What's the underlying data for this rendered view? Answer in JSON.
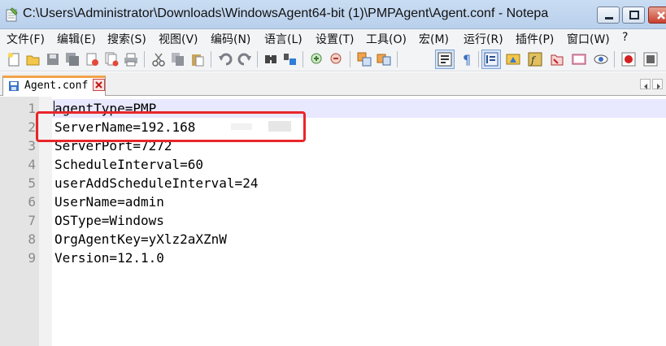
{
  "window": {
    "title": "C:\\Users\\Administrator\\Downloads\\WindowsAgent64-bit (1)\\PMPAgent\\Agent.conf - Notepa"
  },
  "menu": [
    "文件(F)",
    "编辑(E)",
    "搜索(S)",
    "视图(V)",
    "编码(N)",
    "语言(L)",
    "设置(T)",
    "工具(O)",
    "宏(M)",
    "运行(R)",
    "插件(P)",
    "窗口(W)",
    "?"
  ],
  "tab": {
    "label": "Agent.conf"
  },
  "editor": {
    "line_numbers": [
      "1",
      "2",
      "3",
      "4",
      "5",
      "6",
      "7",
      "8",
      "9"
    ],
    "lines": [
      "agentType=PMP",
      "ServerName=192.168",
      "ServerPort=7272",
      "ScheduleInterval=60",
      "userAddScheduleInterval=24",
      "UserName=admin",
      "OSType=Windows",
      "OrgAgentKey=yXlz2aXZnW",
      "Version=12.1.0"
    ]
  },
  "colors": {
    "highlight_box": "#e8262a",
    "current_line": "#e8e8ff",
    "tab_accent": "#f2a34a"
  }
}
